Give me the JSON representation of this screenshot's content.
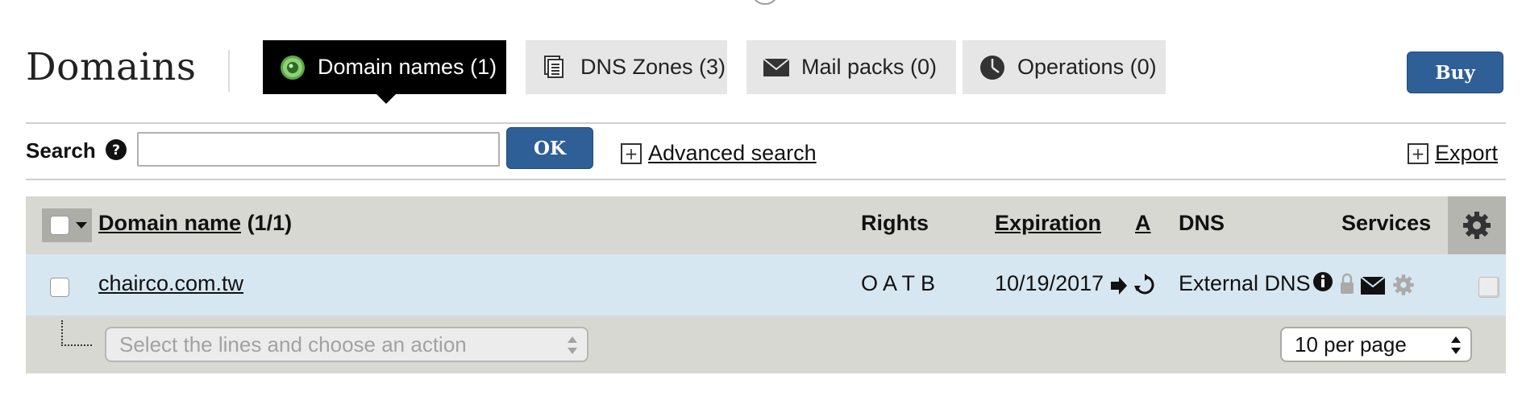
{
  "header": {
    "title": "Domains",
    "buy_label": "Buy"
  },
  "tabs": [
    {
      "label": "Domain names (1)",
      "icon": "domain-globe-icon",
      "active": true
    },
    {
      "label": "DNS Zones (3)",
      "icon": "dns-zones-icon",
      "active": false
    },
    {
      "label": "Mail packs (0)",
      "icon": "envelope-icon",
      "active": false
    },
    {
      "label": "Operations (0)",
      "icon": "clock-icon",
      "active": false
    }
  ],
  "search": {
    "label": "Search",
    "value": "",
    "ok_label": "OK",
    "advanced_label": "Advanced search",
    "export_label": "Export"
  },
  "table": {
    "columns": {
      "domain_name": "Domain name",
      "domain_count": "(1/1)",
      "rights": "Rights",
      "expiration": "Expiration",
      "auto": "A",
      "dns": "DNS",
      "services": "Services"
    },
    "rows": [
      {
        "domain": "chairco.com.tw",
        "rights": "O A T B",
        "expiration": "10/19/2017",
        "dns": "External DNS"
      }
    ],
    "action_placeholder": "Select the lines and choose an action",
    "per_page": "10 per page"
  },
  "colors": {
    "accent_blue": "#2f5f97",
    "active_tab": "#000000",
    "tab_bg": "#e6e6e6",
    "row_highlight": "#d7e7f1",
    "table_header": "#d8d8d3"
  }
}
